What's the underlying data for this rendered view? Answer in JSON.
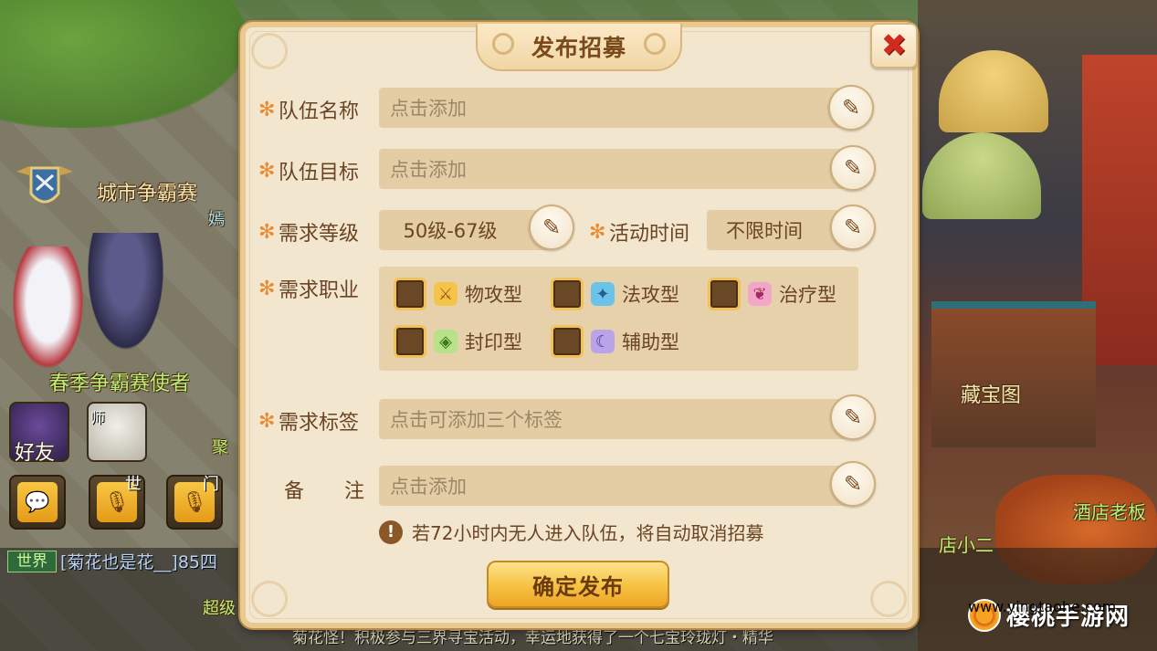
{
  "scene": {
    "npc_city_contest": "城市争霸赛",
    "npc_spring_envoy": "春季争霸赛使者",
    "npc_treasure_map": "藏宝图",
    "npc_hotel_boss": "酒店老板",
    "npc_waiter": "店小二",
    "npc_partial_top": "嫣",
    "npc_partial_right": "聚",
    "npc_partial_bottom": "超级"
  },
  "hud": {
    "friend_label": "好友",
    "master_tag": "师",
    "voice_world_tag": "世",
    "voice_sect_tag": "门",
    "chat_channel": "世界",
    "chat_name": "[菊花也是花__]85四",
    "ticker": "菊花怪！积极参与三界寻宝活动，幸运地获得了一个七宝玲珑灯・精华"
  },
  "watermark": {
    "text": "樱桃手游网",
    "sub": "www.yingtaohe.com"
  },
  "dialog": {
    "title": "发布招募",
    "close_icon": "close-x-icon",
    "team_name": {
      "label": "队伍名称",
      "placeholder": "点击添加"
    },
    "team_goal": {
      "label": "队伍目标",
      "placeholder": "点击添加"
    },
    "level": {
      "label": "需求等级",
      "value": "50级-67级"
    },
    "activity_time": {
      "label": "活动时间",
      "value": "不限时间"
    },
    "jobs": {
      "label": "需求职业",
      "options": [
        {
          "label": "物攻型",
          "icon": "physical-attack-icon",
          "checked": false
        },
        {
          "label": "法攻型",
          "icon": "magic-attack-icon",
          "checked": false
        },
        {
          "label": "治疗型",
          "icon": "healing-icon",
          "checked": false
        },
        {
          "label": "封印型",
          "icon": "seal-icon",
          "checked": false
        },
        {
          "label": "辅助型",
          "icon": "support-icon",
          "checked": false
        }
      ]
    },
    "tags": {
      "label": "需求标签",
      "placeholder": "点击可添加三个标签"
    },
    "note": {
      "label": "备　　注",
      "placeholder": "点击添加"
    },
    "hint": "若72小时内无人进入队伍，将自动取消招募",
    "confirm_label": "确定发布",
    "colors": {
      "panel_bg": "#f3e6cf",
      "field_bg": "#e4cda4",
      "text_brown": "#6a4423",
      "required_star": "#ec8a30",
      "confirm_gold": "#f7c447",
      "close_red": "#d02b1d"
    }
  }
}
